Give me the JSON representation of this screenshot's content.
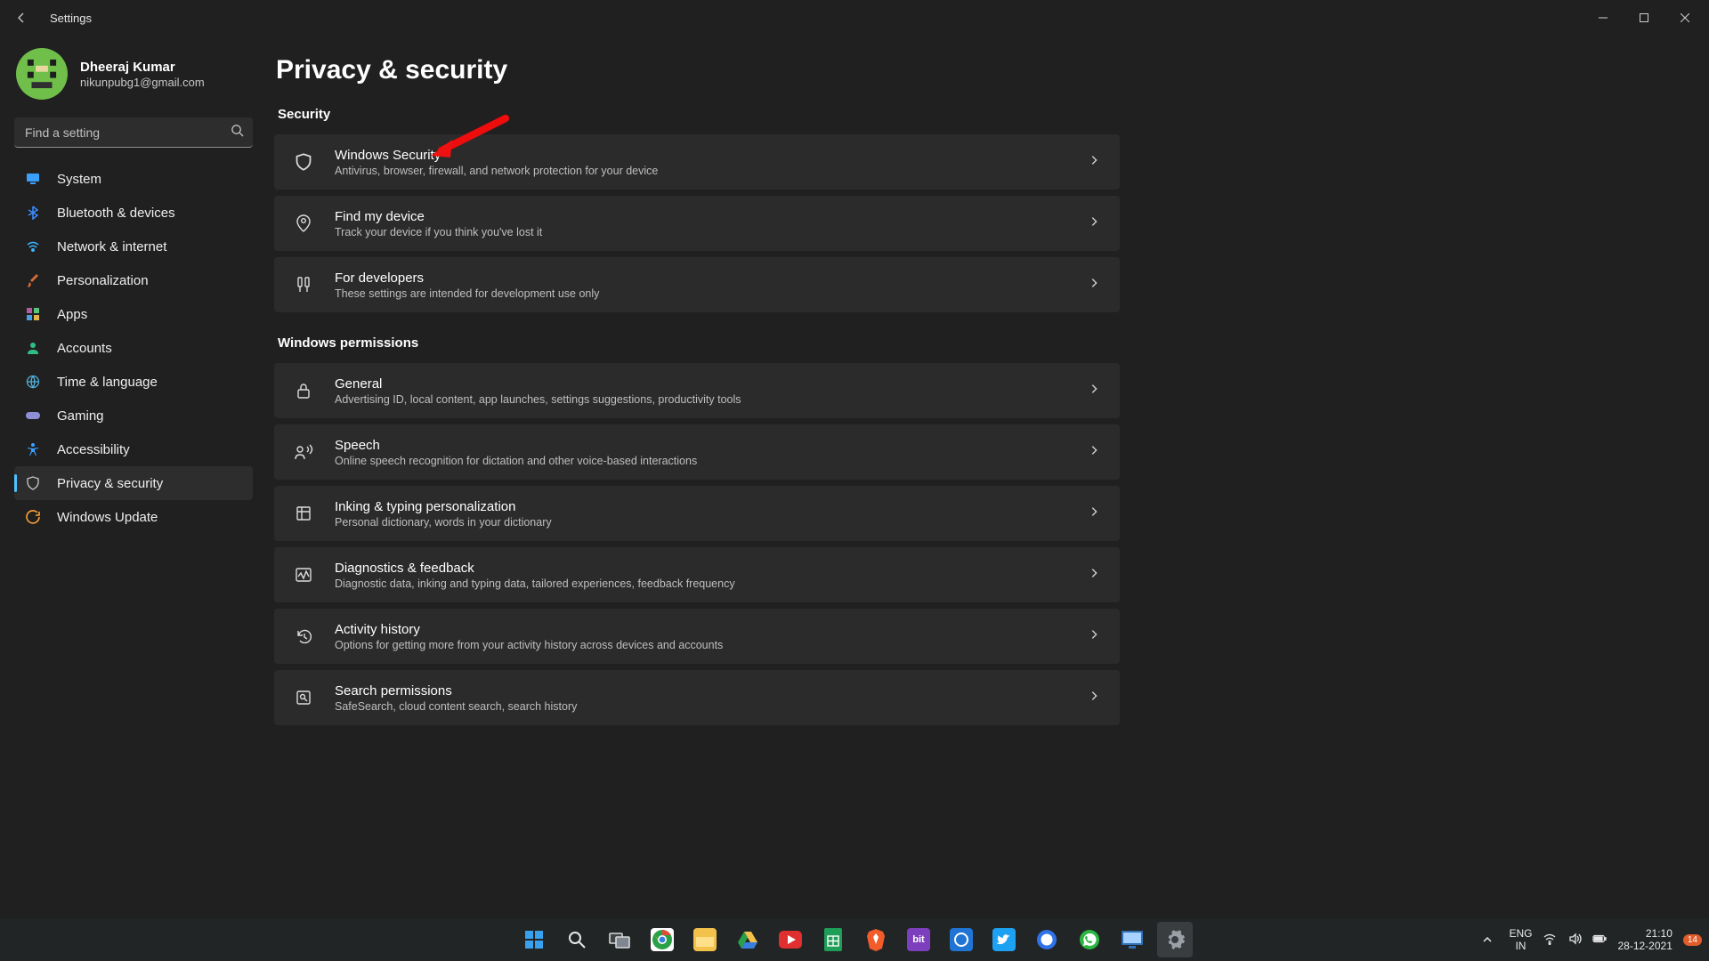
{
  "window": {
    "app_title": "Settings"
  },
  "profile": {
    "name": "Dheeraj Kumar",
    "email": "nikunpubg1@gmail.com"
  },
  "search": {
    "placeholder": "Find a setting"
  },
  "sidebar": {
    "items": [
      {
        "id": "system",
        "label": "System",
        "icon": "monitor",
        "color": "#3aa0ff"
      },
      {
        "id": "bluetooth",
        "label": "Bluetooth & devices",
        "icon": "bluetooth",
        "color": "#3a8dff"
      },
      {
        "id": "network",
        "label": "Network & internet",
        "icon": "wifi",
        "color": "#3ab6ff"
      },
      {
        "id": "personalization",
        "label": "Personalization",
        "icon": "brush",
        "color": "#d66b3a"
      },
      {
        "id": "apps",
        "label": "Apps",
        "icon": "grid",
        "color": "#b45aa0"
      },
      {
        "id": "accounts",
        "label": "Accounts",
        "icon": "person",
        "color": "#2fbf86"
      },
      {
        "id": "time",
        "label": "Time & language",
        "icon": "globe",
        "color": "#4fb0d8"
      },
      {
        "id": "gaming",
        "label": "Gaming",
        "icon": "gamepad",
        "color": "#8f8fd8"
      },
      {
        "id": "accessibility",
        "label": "Accessibility",
        "icon": "accessibility",
        "color": "#3aa0ff"
      },
      {
        "id": "privacy",
        "label": "Privacy & security",
        "icon": "shield",
        "color": "#bfbfbf",
        "active": true
      },
      {
        "id": "update",
        "label": "Windows Update",
        "icon": "sync",
        "color": "#ff9f3a"
      }
    ]
  },
  "page": {
    "title": "Privacy & security",
    "sections": [
      {
        "heading": "Security",
        "items": [
          {
            "id": "winsec",
            "icon": "shield",
            "title": "Windows Security",
            "desc": "Antivirus, browser, firewall, and network protection for your device"
          },
          {
            "id": "findmy",
            "icon": "geo-person",
            "title": "Find my device",
            "desc": "Track your device if you think you've lost it"
          },
          {
            "id": "dev",
            "icon": "dev-tools",
            "title": "For developers",
            "desc": "These settings are intended for development use only"
          }
        ]
      },
      {
        "heading": "Windows permissions",
        "items": [
          {
            "id": "general",
            "icon": "lock",
            "title": "General",
            "desc": "Advertising ID, local content, app launches, settings suggestions, productivity tools"
          },
          {
            "id": "speech",
            "icon": "speech",
            "title": "Speech",
            "desc": "Online speech recognition for dictation and other voice-based interactions"
          },
          {
            "id": "inking",
            "icon": "inking",
            "title": "Inking & typing personalization",
            "desc": "Personal dictionary, words in your dictionary"
          },
          {
            "id": "diag",
            "icon": "diagnostics",
            "title": "Diagnostics & feedback",
            "desc": "Diagnostic data, inking and typing data, tailored experiences, feedback frequency"
          },
          {
            "id": "activity",
            "icon": "history",
            "title": "Activity history",
            "desc": "Options for getting more from your activity history across devices and accounts"
          },
          {
            "id": "searchperm",
            "icon": "search-perm",
            "title": "Search permissions",
            "desc": "SafeSearch, cloud content search, search history"
          }
        ]
      }
    ]
  },
  "taskbar": {
    "apps": [
      {
        "id": "start",
        "name": "start-button",
        "bg": "transparent"
      },
      {
        "id": "search",
        "name": "search-button",
        "bg": "transparent"
      },
      {
        "id": "taskview",
        "name": "task-view-button",
        "bg": "transparent"
      },
      {
        "id": "chrome",
        "name": "chrome",
        "bg": "#fff"
      },
      {
        "id": "explorer",
        "name": "file-explorer",
        "bg": "#f2c24b"
      },
      {
        "id": "drive",
        "name": "google-drive",
        "bg": "transparent"
      },
      {
        "id": "youtube",
        "name": "youtube",
        "bg": "transparent"
      },
      {
        "id": "sheets",
        "name": "google-sheets",
        "bg": "transparent"
      },
      {
        "id": "brave",
        "name": "brave",
        "bg": "transparent"
      },
      {
        "id": "bit",
        "name": "bit-app",
        "bg": "#7e3fbf",
        "label": "bit"
      },
      {
        "id": "circle",
        "name": "blue-circle-app",
        "bg": "#1f74d4"
      },
      {
        "id": "twitter",
        "name": "twitter",
        "bg": "#1da1f2"
      },
      {
        "id": "signal",
        "name": "signal",
        "bg": "transparent"
      },
      {
        "id": "whatsapp",
        "name": "whatsapp",
        "bg": "transparent"
      },
      {
        "id": "monitor",
        "name": "monitor-app",
        "bg": "transparent"
      },
      {
        "id": "settings",
        "name": "settings-app",
        "bg": "#3a3d3f",
        "active": true
      }
    ],
    "lang_top": "ENG",
    "lang_bottom": "IN",
    "time": "21:10",
    "date": "28-12-2021",
    "notification_count": "14"
  }
}
